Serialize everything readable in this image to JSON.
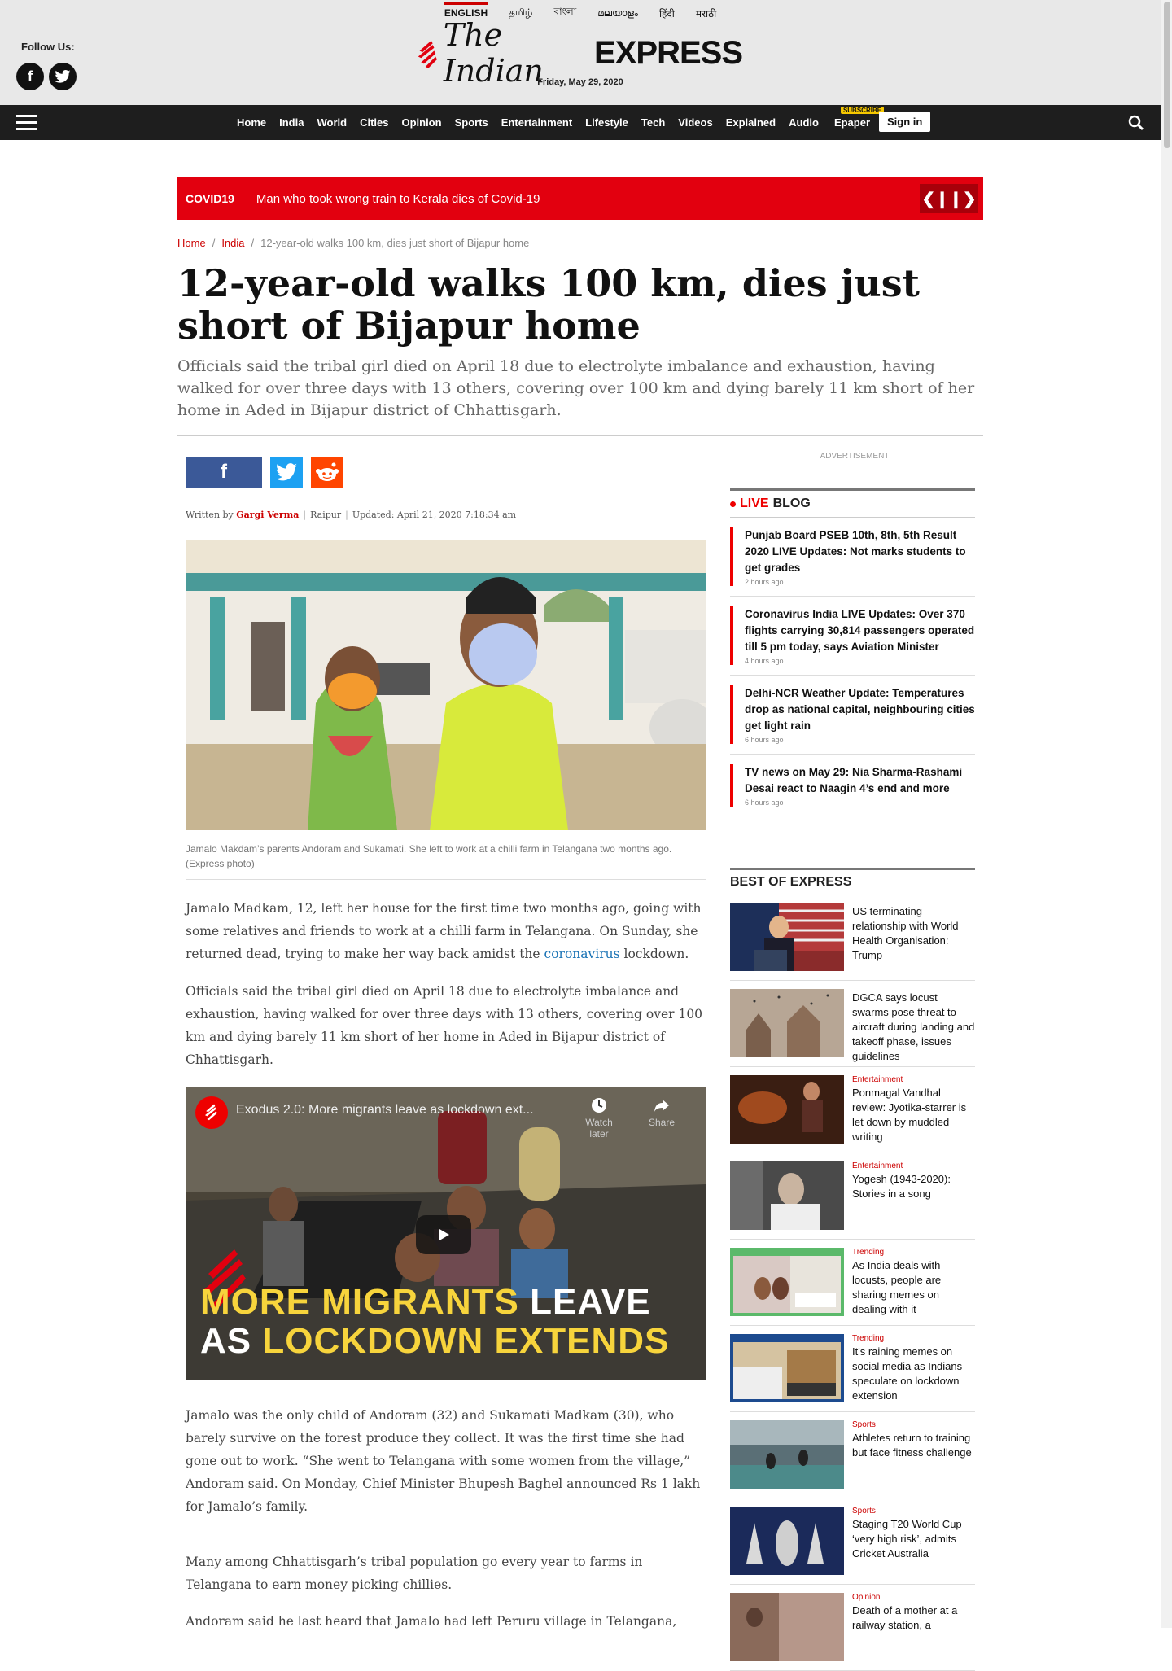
{
  "langs": [
    "ENGLISH",
    "தமிழ்",
    "বাংলা",
    "മലയാളം",
    "हिंदी",
    "मराठी"
  ],
  "header": {
    "follow": "Follow Us:",
    "logo_the": "The Indian",
    "logo_exp": "EXPRESS",
    "date": "Friday, May 29, 2020"
  },
  "nav": {
    "links": [
      "Home",
      "India",
      "World",
      "Cities",
      "Opinion",
      "Sports",
      "Entertainment",
      "Lifestyle",
      "Tech",
      "Videos",
      "Explained",
      "Audio"
    ],
    "epaper": "Epaper",
    "subscribe": "SUBSCRIBE",
    "signin": "Sign in"
  },
  "ticker": {
    "tag": "COVID19",
    "text": "Man who took wrong train to Kerala dies of Covid-19",
    "controls": "❮❙❙❯"
  },
  "breadcrumb": {
    "home": "Home",
    "india": "India",
    "current": "12-year-old walks 100 km, dies just short of Bijapur home"
  },
  "article": {
    "title": "12-year-old walks 100 km, dies just short of Bijapur home",
    "synopsis": "Officials said the tribal girl died on April 18 due to electrolyte imbalance and exhaustion, having walked for over three days with 13 others, covering over 100 km and dying barely 11 km short of her home in Aded in Bijapur district of Chhattisgarh.",
    "written_by": "Written by",
    "author": "Gargi Verma",
    "location": "Raipur",
    "updated": "Updated: April 21, 2020 7:18:34 am",
    "caption": "Jamalo Makdam’s parents Andoram and Sukamati. She left to work at a chilli farm in Telangana two months ago. (Express photo)",
    "p1a": "Jamalo Madkam, 12, left her house for the first time two months ago, going with some relatives and friends to work at a chilli farm in Telangana. On Sunday, she returned dead, trying to make her way back amidst the ",
    "p1link": "coronavirus",
    "p1b": " lockdown.",
    "p2": "Officials said the tribal girl died on April 18 due to electrolyte imbalance and exhaustion, having walked for over three days with 13 others, covering over 100 km and dying barely 11 km short of her home in Aded in Bijapur district of Chhattisgarh.",
    "p3": "Jamalo was the only child of Andoram (32) and Sukamati Madkam (30), who barely survive on the forest produce they collect. It was the first time she had gone out to work. “She went to Telangana with some women from the village,” Andoram said. On Monday, Chief Minister Bhupesh Baghel announced  Rs 1 lakh for Jamalo’s family.",
    "p4": "Many among Chhattisgarh’s tribal population go every year to farms in Telangana to earn money picking chillies.",
    "p5": "Andoram said he last heard that Jamalo had left Peruru village in Telangana,"
  },
  "video": {
    "title": "Exodus 2.0: More migrants leave as lockdown ext...",
    "watch_later": "Watch later",
    "share": "Share",
    "line1a": "MORE MIGRANTS",
    "line1b": " LEAVE",
    "line2a": "AS ",
    "line2b": "LOCKDOWN EXTENDS"
  },
  "sidebar": {
    "ad": "ADVERTISEMENT",
    "live": "LIVE",
    "blog": "BLOG",
    "liveblog": [
      {
        "title": "Punjab Board PSEB 10th, 8th, 5th Result 2020 LIVE Updates: Not marks students to get grades",
        "time": "2 hours ago"
      },
      {
        "title": "Coronavirus India LIVE Updates: Over 370 flights carrying 30,814 passengers operated till 5 pm today, says Aviation Minister",
        "time": "4 hours ago"
      },
      {
        "title": "Delhi-NCR Weather Update: Temperatures drop as national capital, neighbouring cities get light rain",
        "time": "6 hours ago"
      },
      {
        "title": "TV news on May 29: Nia Sharma-Rashami Desai react to Naagin 4’s end and more",
        "time": "6 hours ago"
      }
    ],
    "best_head": "BEST OF EXPRESS",
    "best": [
      {
        "cat": "",
        "title": "US terminating relationship with World Health Organisation: Trump"
      },
      {
        "cat": "",
        "title": "DGCA says locust swarms pose threat to aircraft during landing and takeoff phase, issues guidelines"
      },
      {
        "cat": "Entertainment",
        "title": "Ponmagal Vandhal review: Jyotika-starrer is let down by muddled writing"
      },
      {
        "cat": "Entertainment",
        "title": "Yogesh (1943-2020): Stories in a song"
      },
      {
        "cat": "Trending",
        "title": "As India deals with locusts, people are sharing memes on dealing with it"
      },
      {
        "cat": "Trending",
        "title": "It's raining memes on social media as Indians speculate on lockdown extension"
      },
      {
        "cat": "Sports",
        "title": "Athletes return to training but face fitness challenge"
      },
      {
        "cat": "Sports",
        "title": "Staging T20 World Cup ‘very high risk’, admits Cricket Australia"
      },
      {
        "cat": "Opinion",
        "title": "Death of a mother at a railway station, a"
      }
    ]
  },
  "colors": {
    "accent": "#e2000f",
    "nav": "#1e1e1e",
    "link": "#1a73b5"
  }
}
